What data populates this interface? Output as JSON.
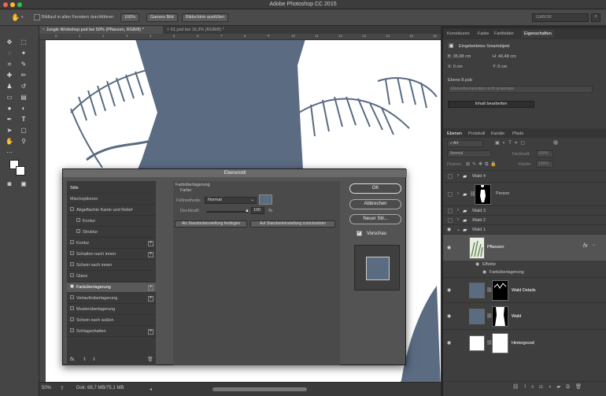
{
  "app": {
    "title": "Adobe Photoshop CC 2015"
  },
  "optionsbar": {
    "scroll_all_label": "Bildlauf in allen Fenstern durchführen",
    "zoom_label": "100%",
    "fit_label": "Ganzes Bild",
    "fill_label": "Bildschirm ausfüllen",
    "workspace": "GABOR"
  },
  "doc_tabs": [
    {
      "label": "Jungle Workshop.psd bei 50% (Pflanzen, RGB/8) *"
    },
    {
      "label": "01.psd bei 16,3% (RGB/8) *"
    }
  ],
  "statusbar": {
    "zoom": "50%",
    "doc": "Dok: 68,7 MB/75,1 MB"
  },
  "ruler_ticks": [
    "0",
    "1",
    "2",
    "3",
    "4",
    "5",
    "6",
    "7",
    "8",
    "9",
    "10",
    "11",
    "12",
    "13",
    "14",
    "15",
    "16"
  ],
  "props": {
    "tabs": [
      "Korrekturen",
      "Farbe",
      "Farbfelder",
      "Eigenschaften"
    ],
    "object_type": "Eingebettetes Smartobjekt",
    "b": "B: 35,08 cm",
    "h": "H: 40,48 cm",
    "x": "X: 0 cm",
    "y": "Y: 0 cm",
    "file": "Ebene 8.psb",
    "comp": "Ebenenkomposition nicht anwenden",
    "edit_button": "Inhalt bearbeiten"
  },
  "layers": {
    "tabs": [
      "Ebenen",
      "Protokoll",
      "Kanäle",
      "Pfade"
    ],
    "filter": "Art",
    "blend_mode": "Normal",
    "opacity_label": "Deckkraft:",
    "opacity": "100%",
    "lock_label": "Fixieren:",
    "fill_label": "Fläche:",
    "fill": "100%",
    "rows": [
      {
        "name": "Wald 4"
      },
      {
        "name": "Person"
      },
      {
        "name": "Wald 3"
      },
      {
        "name": "Wald 2"
      },
      {
        "name": "Wald 1"
      },
      {
        "name": "Pflanzen"
      },
      {
        "name": "Effekte"
      },
      {
        "name": "Farbüberlagerung"
      },
      {
        "name": "Wald Details"
      },
      {
        "name": "Wald"
      },
      {
        "name": "Hintergrund"
      }
    ]
  },
  "dialog": {
    "title": "Ebenenstil",
    "styles": [
      "Stile",
      "Mischoptionen",
      "Abgeflachte Kante und Relief",
      "Kontur",
      "Struktur",
      "Kontur",
      "Schatten nach innen",
      "Schein nach innen",
      "Glanz",
      "Farbüberlagerung",
      "Verlaufsüberlagerung",
      "Musterüberlagerung",
      "Schein nach außen",
      "Schlagschatten"
    ],
    "section_title": "Farbüberlagerung",
    "section_sub": "Farbe",
    "blend_label": "Füllmethode:",
    "blend_value": "Normal",
    "opacity_label": "Deckkraft:",
    "opacity_value": "100",
    "opacity_unit": "%",
    "set_default": "Als Standardeinstellung festlegen",
    "reset_default": "Auf Standardeinstellung zurücksetzen",
    "ok": "OK",
    "cancel": "Abbrechen",
    "new_style": "Neuer Stil...",
    "preview": "Vorschau",
    "fx": "fx."
  },
  "colors": {
    "overlay": "#5a6b82",
    "accent": "#5a6b82"
  }
}
